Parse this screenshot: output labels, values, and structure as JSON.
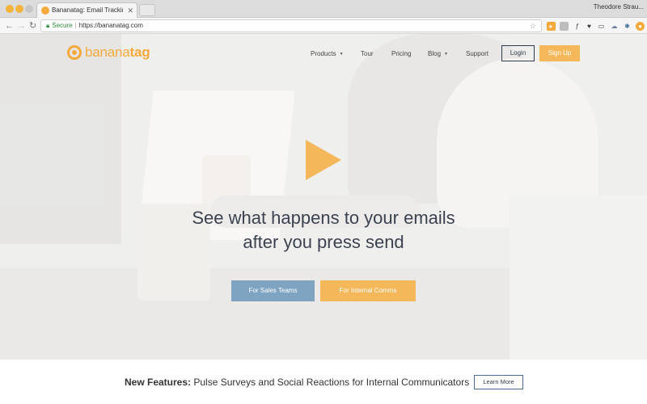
{
  "browser": {
    "tab_title": "Bananatag: Email Tracking, Em",
    "tab_close": "✕",
    "profile_name": "Theodore Strau...",
    "secure_label": "Secure",
    "url": "https://bananatag.com",
    "nav_back": "←",
    "nav_forward": "→",
    "nav_reload": "↻",
    "star": "☆"
  },
  "site": {
    "logo": {
      "light": "banana",
      "bold": "tag"
    },
    "nav": [
      {
        "label": "Products",
        "caret": "▼"
      },
      {
        "label": "Tour"
      },
      {
        "label": "Pricing"
      },
      {
        "label": "Blog",
        "caret": "▼"
      },
      {
        "label": "Support"
      }
    ],
    "login_label": "Login",
    "signup_label": "Sign Up",
    "headline_line1": "See what happens to your emails",
    "headline_line2": "after you press send",
    "cta_sales": "For Sales Teams",
    "cta_internal": "For Internal Comms",
    "features": {
      "lead": "New Features:",
      "text": " Pulse Surveys and Social Reactions for Internal Communicators",
      "button": "Learn More"
    }
  },
  "colors": {
    "brand_orange": "#f4b85a",
    "sales_blue": "#7ea4c2",
    "navy": "#2f3b4c"
  }
}
